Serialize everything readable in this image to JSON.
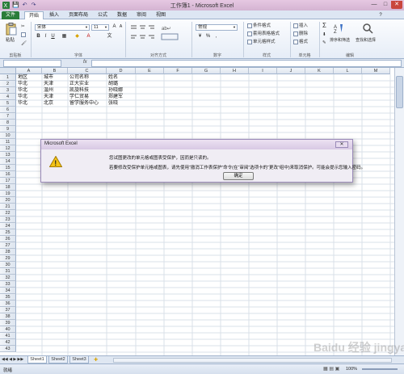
{
  "window": {
    "title": "工作簿1 - Microsoft Excel",
    "buttons": [
      "—",
      "□",
      "✕"
    ]
  },
  "quick_access": [
    "💾",
    "↶",
    "↷"
  ],
  "tabs": [
    {
      "label": "文件",
      "state": "file"
    },
    {
      "label": "开始",
      "state": "active"
    },
    {
      "label": "插入"
    },
    {
      "label": "页面布局"
    },
    {
      "label": "公式"
    },
    {
      "label": "数据"
    },
    {
      "label": "审阅"
    },
    {
      "label": "视图"
    }
  ],
  "ribbon": {
    "clipboard": {
      "paste": "粘贴",
      "group": "剪贴板"
    },
    "font": {
      "font_name": "宋体",
      "font_size": "11",
      "bold": "B",
      "italic": "I",
      "underline": "U",
      "group": "字体"
    },
    "alignment": {
      "group": "对齐方式"
    },
    "number": {
      "format": "常规",
      "group": "数字"
    },
    "styles": {
      "conditional": "条件格式",
      "table": "套用表格格式",
      "cell": "单元格样式",
      "group": "样式"
    },
    "cells": {
      "insert": "插入",
      "delete": "删除",
      "format": "格式",
      "group": "单元格"
    },
    "editing": {
      "sort_filter": "排序和筛选",
      "find_select": "查找和选择",
      "sigma": "Σ",
      "group": "编辑"
    }
  },
  "formula_bar": {
    "fx": "fx",
    "name_box": "",
    "value": ""
  },
  "columns": [
    "A",
    "B",
    "C",
    "D",
    "E",
    "F",
    "G",
    "H",
    "I",
    "J",
    "K",
    "L",
    "M"
  ],
  "row_count": 43,
  "cells": [
    [
      "地区",
      "城市",
      "公司名称",
      "姓名"
    ],
    [
      "华北",
      "天津",
      "正大实业",
      "胡璐"
    ],
    [
      "华北",
      "温州",
      "凯旋科技",
      "孙晓娜"
    ],
    [
      "华北",
      "天津",
      "学仁贸易",
      "郑建军"
    ],
    [
      "华北",
      "北京",
      "留学服务中心",
      "张晓"
    ]
  ],
  "sheets": [
    "Sheet1",
    "Sheet2",
    "Sheet3"
  ],
  "status": {
    "ready": "就绪",
    "zoom": "100%"
  },
  "dialog": {
    "title": "Microsoft Excel",
    "close": "✕",
    "message1": "您试图更改的单元格或图表受保护，因而是只读的。",
    "message2": "若要修改受保护单元格或图表，请先使用“撤消工作表保护”命令(在“审阅”选项卡的“更改”组中)来取消保护。可能会提示您输入密码。",
    "ok": "确定"
  },
  "watermark": "Baidu 经验 jingyan.baidu.com",
  "colors": {
    "file_tab": "#2a7d3a",
    "dialog_border": "#9a8ab8",
    "title_bar": "#d4b4d2"
  }
}
